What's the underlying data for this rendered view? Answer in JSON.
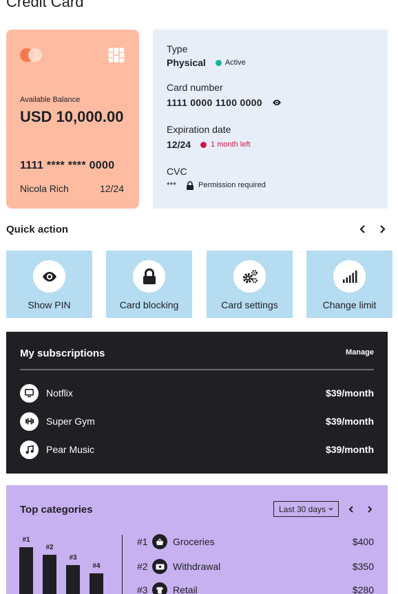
{
  "page": {
    "title": "Credit Card"
  },
  "card": {
    "balance_label": "Available Balance",
    "balance_value": "USD 10,000.00",
    "number_masked": "1111 **** **** 0000",
    "holder": "Nicola Rich",
    "expiry": "12/24",
    "brand_colors": {
      "background": "#fdbca2",
      "logo_left": "#f47a52",
      "logo_right": "#fde0d2"
    }
  },
  "details": {
    "type_label": "Type",
    "type_value": "Physical",
    "type_status": "Active",
    "number_label": "Card number",
    "number_value": "1111 0000 1100 0000",
    "expiration_label": "Expiration date",
    "expiration_value": "12/24",
    "expiration_note": "1 month left",
    "cvc_label": "CVC",
    "cvc_value": "***",
    "cvc_note": "Permission required",
    "status_colors": {
      "active": "#1cb39b",
      "warning": "#d1164a"
    }
  },
  "quick_action": {
    "title": "Quick action",
    "actions": [
      {
        "label": "Show PIN",
        "icon": "eye-icon"
      },
      {
        "label": "Card blocking",
        "icon": "lock-icon"
      },
      {
        "label": "Card settings",
        "icon": "gears-icon"
      },
      {
        "label": "Change limit",
        "icon": "signal-bars-icon"
      }
    ]
  },
  "subscriptions": {
    "title": "My subscriptions",
    "manage_label": "Manage",
    "items": [
      {
        "name": "Notflix",
        "price": "$39/month",
        "icon": "tv-icon"
      },
      {
        "name": "Super Gym",
        "price": "$39/month",
        "icon": "dumbbell-icon"
      },
      {
        "name": "Pear Music",
        "price": "$39/month",
        "icon": "music-note-icon"
      }
    ]
  },
  "top_categories": {
    "title": "Top categories",
    "range": "Last 30 days",
    "bars": [
      {
        "label": "#1",
        "value": 400
      },
      {
        "label": "#2",
        "value": 350
      },
      {
        "label": "#3",
        "value": 280
      },
      {
        "label": "#4",
        "value": 220
      }
    ],
    "items": [
      {
        "rank": "#1",
        "name": "Groceries",
        "amount": "$400",
        "icon": "basket-icon"
      },
      {
        "rank": "#2",
        "name": "Withdrawal",
        "amount": "$350",
        "icon": "cash-icon"
      },
      {
        "rank": "#3",
        "name": "Retail",
        "amount": "$280",
        "icon": "shirt-icon"
      }
    ]
  }
}
